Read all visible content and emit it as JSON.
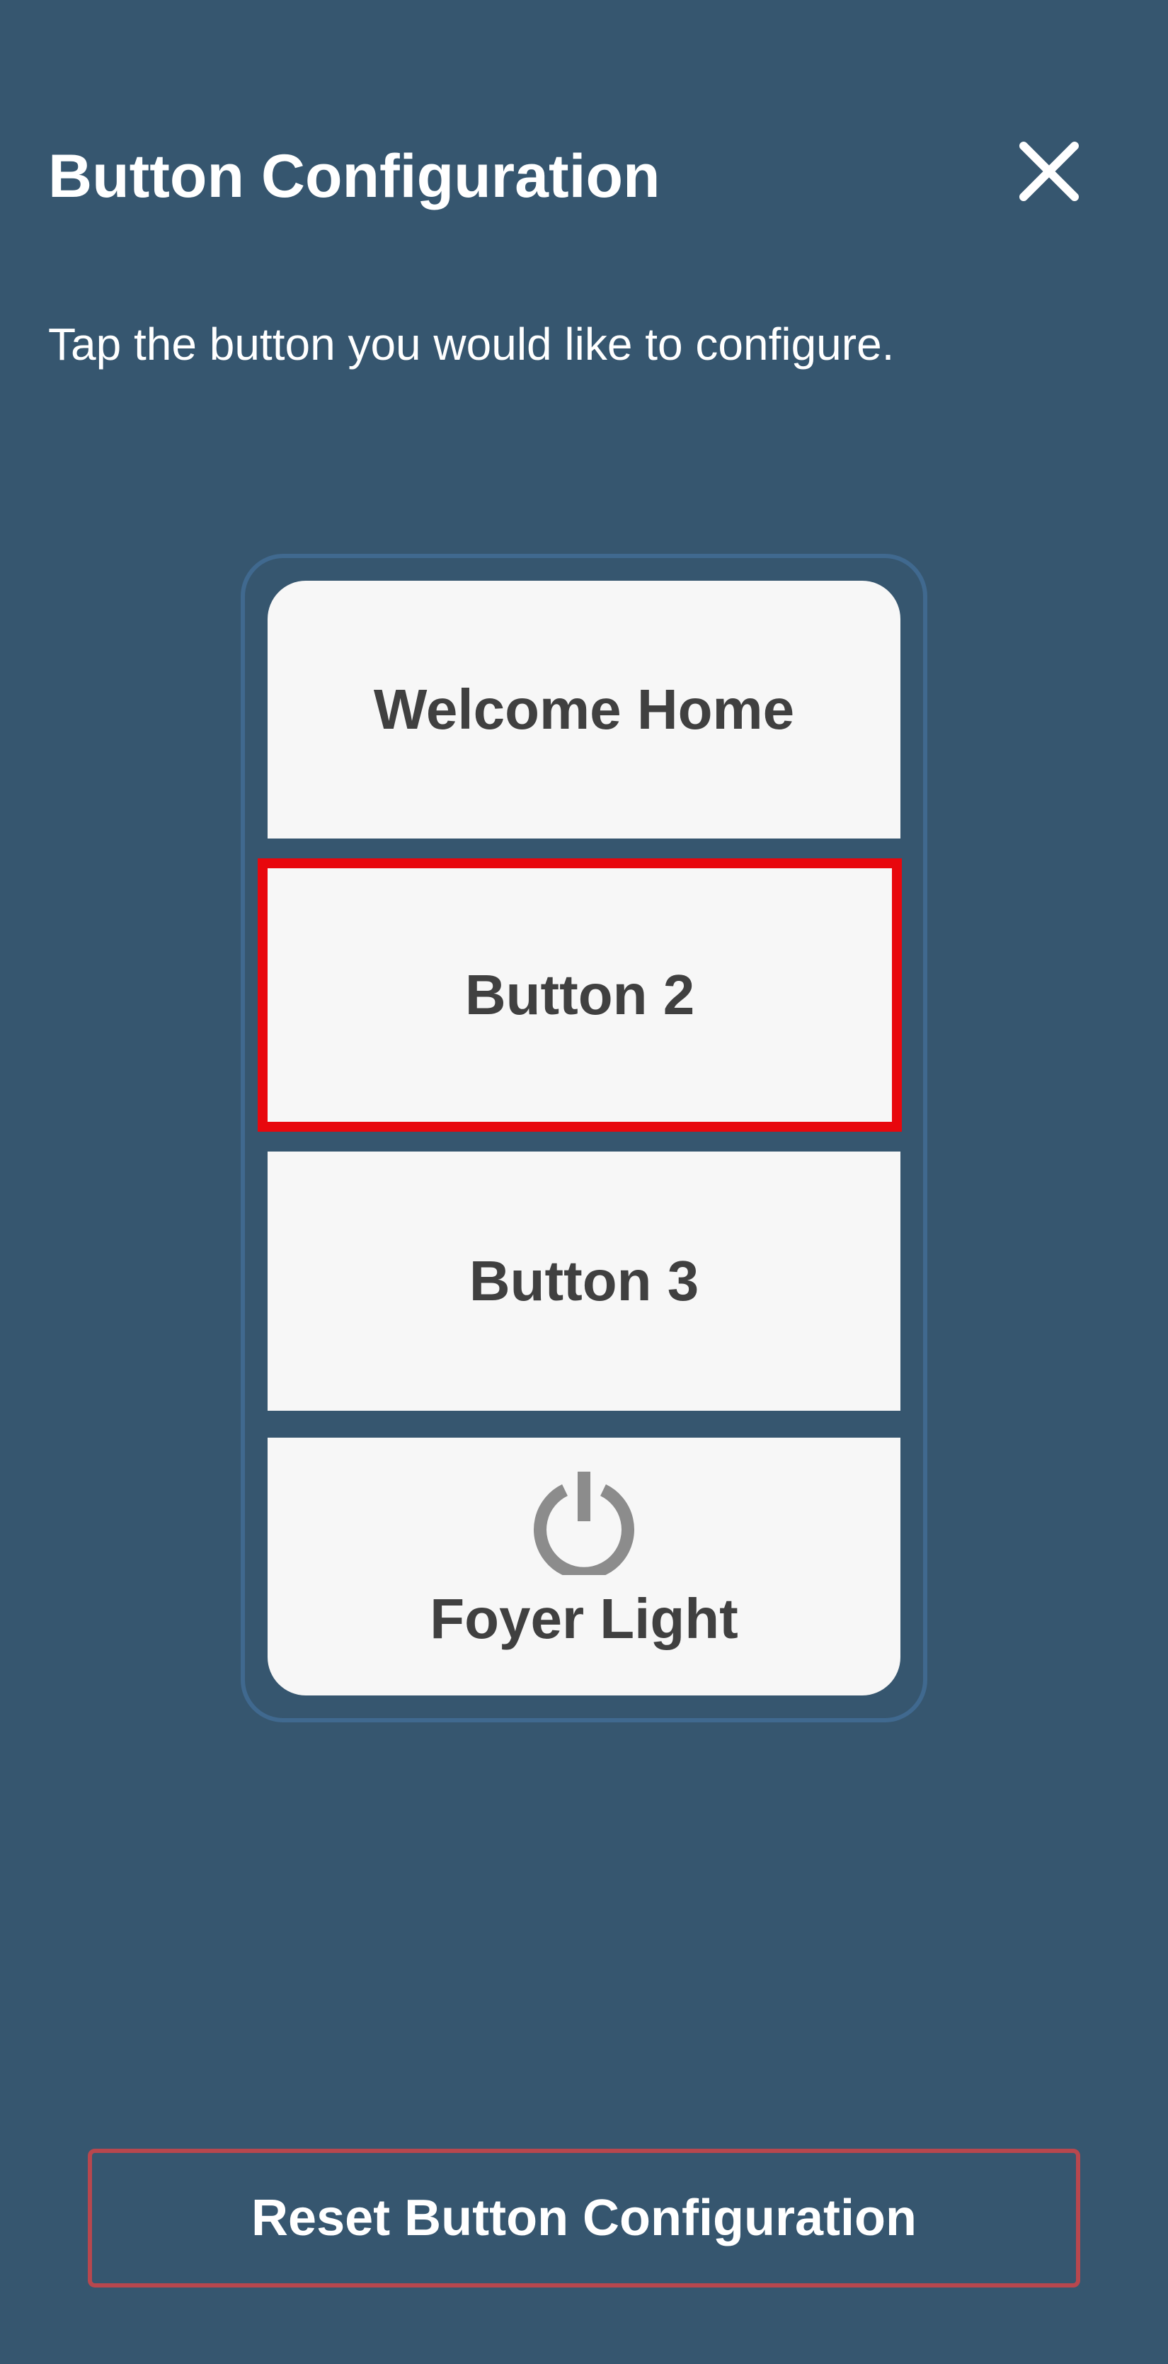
{
  "header": {
    "title": "Button Configuration",
    "close_icon": "close-icon"
  },
  "instructions": "Tap the button you would like to configure.",
  "keypad": {
    "buttons": [
      {
        "label": "Welcome Home",
        "selected": false
      },
      {
        "label": "Button 2",
        "selected": true
      },
      {
        "label": "Button 3",
        "selected": false
      },
      {
        "label": "Foyer Light",
        "icon": "power-icon",
        "selected": false
      }
    ]
  },
  "footer": {
    "reset_label": "Reset Button Configuration"
  },
  "colors": {
    "background": "#36566f",
    "key_background": "#f7f7f7",
    "key_text": "#404040",
    "selected_border": "#e8070d",
    "keypad_outline": "#40698f",
    "reset_border": "#b7474e",
    "power_icon": "#8c8c8c"
  }
}
